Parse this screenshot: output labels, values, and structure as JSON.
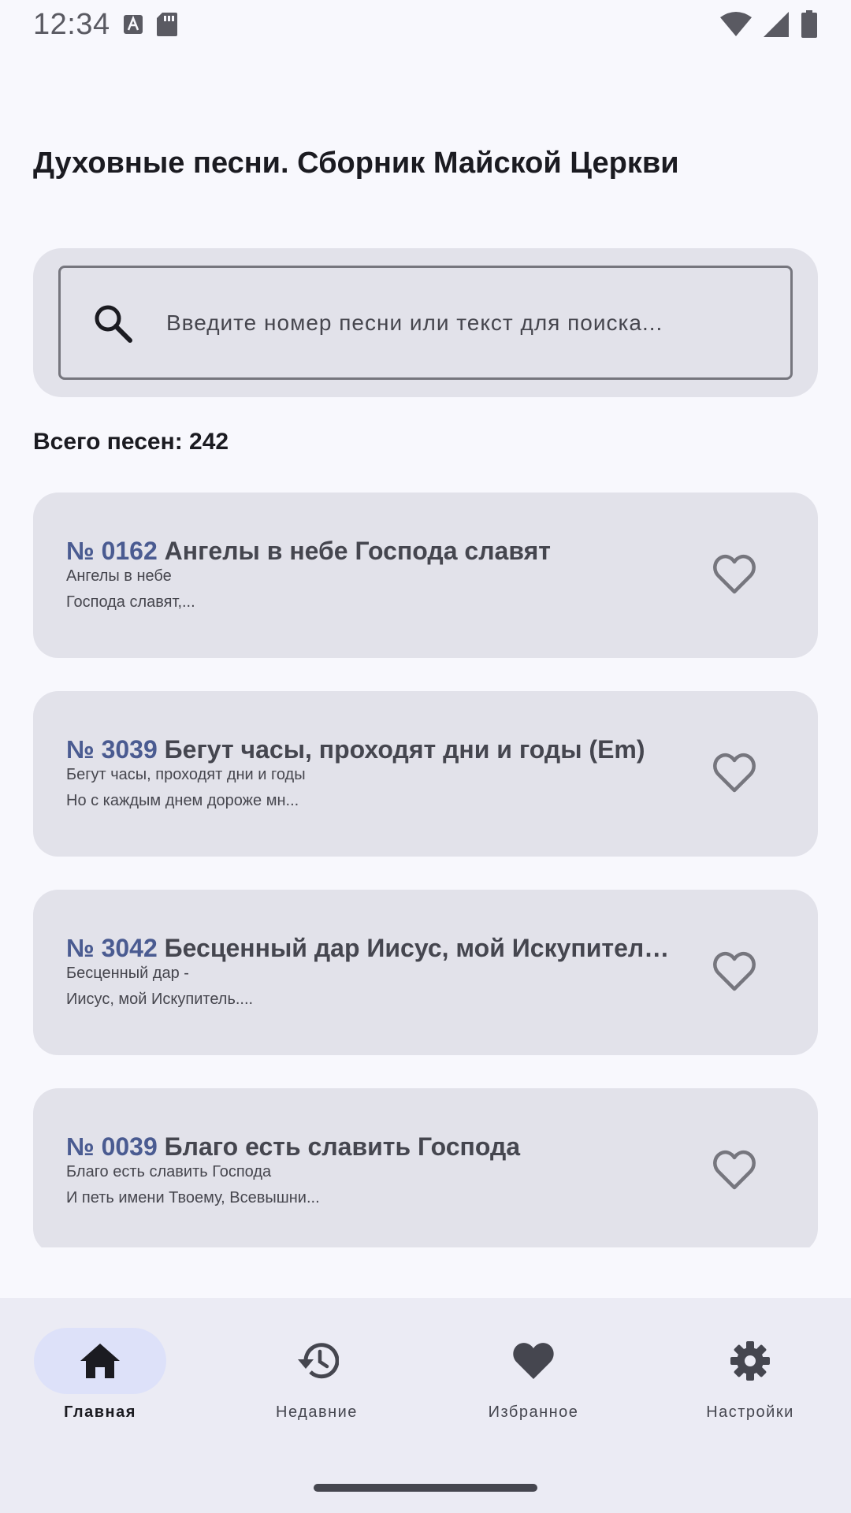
{
  "status_bar": {
    "time": "12:34"
  },
  "app": {
    "title": "Духовные песни. Сборник Майской Церкви"
  },
  "search": {
    "placeholder": "Введите номер песни или текст для поиска..."
  },
  "summary": {
    "total_label": "Всего песен: 242"
  },
  "songs": [
    {
      "number": "№ 0162",
      "title": "Ангелы в небе Господа славят",
      "line1": "Ангелы в небе",
      "line2": "Господа славят,..."
    },
    {
      "number": "№ 3039",
      "title": "Бегут часы, проходят дни и годы (Em)",
      "line1": "Бегут часы, проходят дни и годы",
      "line2": "Но с каждым днем дороже мн..."
    },
    {
      "number": "№ 3042",
      "title": "Бесценный дар Иисус, мой Искупитель ...",
      "line1": "Бесценный дар -",
      "line2": "Иисус, мой Искупитель...."
    },
    {
      "number": "№ 0039",
      "title": "Благо есть славить Господа",
      "line1": "Благо есть славить Господа",
      "line2": "И петь имени Твоему, Всевышни..."
    }
  ],
  "bottom_nav": {
    "items": [
      {
        "label": "Главная",
        "icon": "home-icon",
        "active": true
      },
      {
        "label": "Недавние",
        "icon": "history-icon",
        "active": false
      },
      {
        "label": "Избранное",
        "icon": "heart-filled-icon",
        "active": false
      },
      {
        "label": "Настройки",
        "icon": "gear-icon",
        "active": false
      }
    ]
  },
  "colors": {
    "background": "#f8f8fd",
    "card": "#e2e2ea",
    "accent_number": "#4a5b91",
    "nav_active_pill": "#dde1f9"
  }
}
